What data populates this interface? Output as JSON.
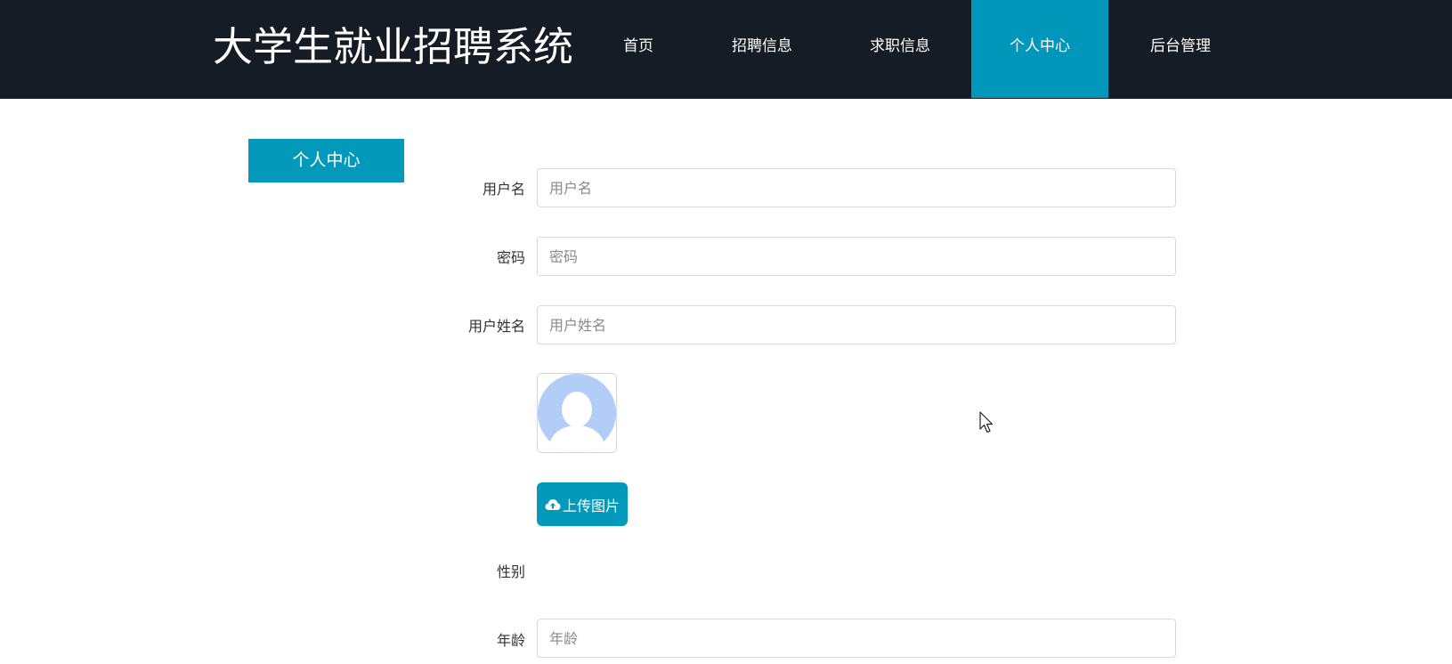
{
  "header": {
    "site_title": "大学生就业招聘系统",
    "nav": [
      {
        "label": "首页",
        "active": false
      },
      {
        "label": "招聘信息",
        "active": false
      },
      {
        "label": "求职信息",
        "active": false
      },
      {
        "label": "个人中心",
        "active": true
      },
      {
        "label": "后台管理",
        "active": false
      }
    ]
  },
  "sidebar": {
    "personal_center_button": "个人中心"
  },
  "form": {
    "username": {
      "label": "用户名",
      "placeholder": "用户名",
      "value": ""
    },
    "password": {
      "label": "密码",
      "placeholder": "密码",
      "value": ""
    },
    "real_name": {
      "label": "用户姓名",
      "placeholder": "用户姓名",
      "value": ""
    },
    "avatar": {
      "icon": "default-user-avatar-icon"
    },
    "upload_button": {
      "label": "上传图片",
      "icon": "cloud-upload-icon"
    },
    "gender": {
      "label": "性别"
    },
    "age": {
      "label": "年龄",
      "placeholder": "年龄",
      "value": ""
    }
  },
  "colors": {
    "header_bg": "#161c25",
    "accent": "#0399bb",
    "avatar_fill": "#b1cdf8"
  }
}
